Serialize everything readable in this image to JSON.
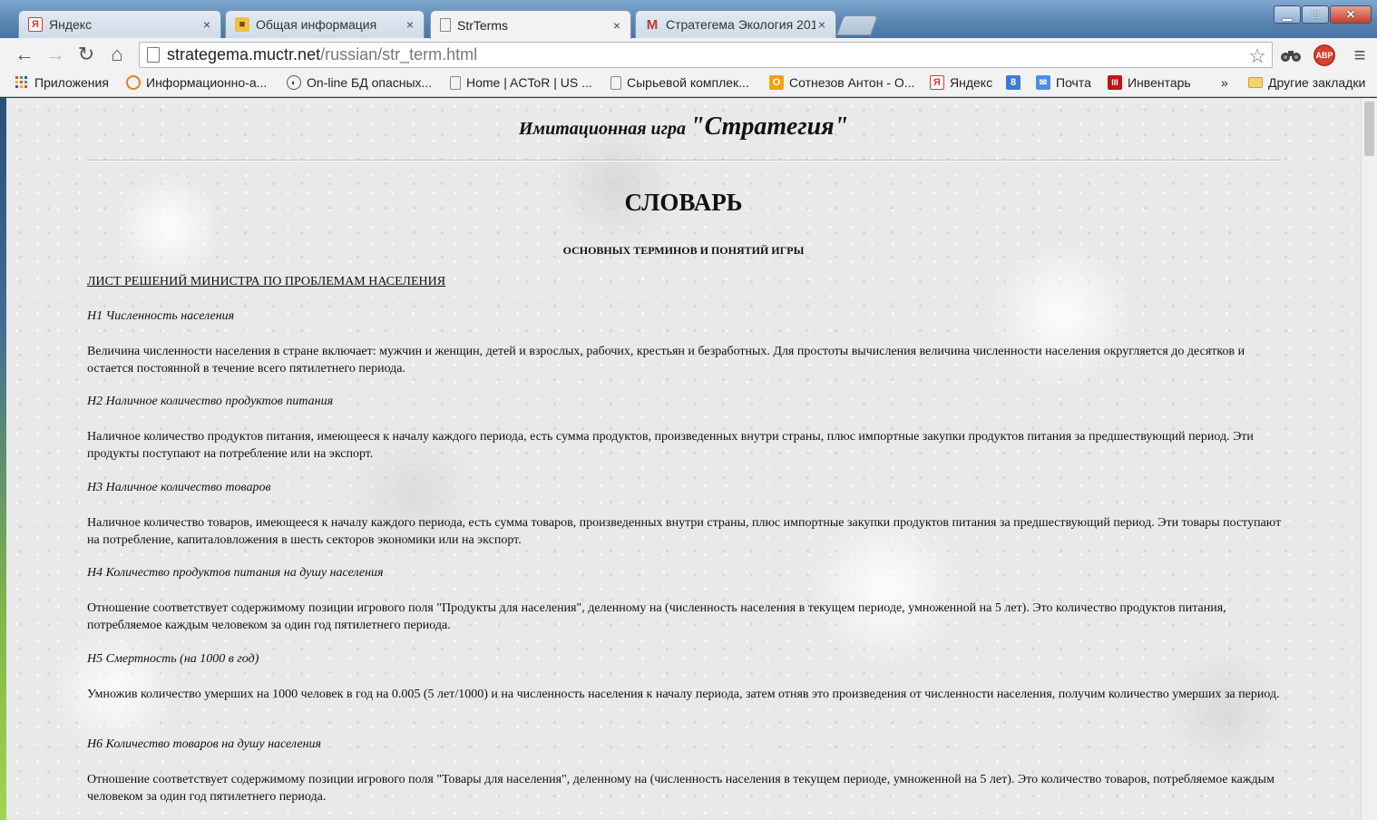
{
  "browser": {
    "tabs": [
      {
        "title": "Яндекс",
        "icon": "yandex-icon"
      },
      {
        "title": "Общая информация",
        "icon": "info-icon"
      },
      {
        "title": "StrTerms",
        "icon": "page-icon",
        "active": true
      },
      {
        "title": "Стратегема Экология 201",
        "icon": "gmail-icon"
      }
    ],
    "close_glyph": "×",
    "address": {
      "host": "strategema.muctr.net",
      "path": "/russian/str_term.html"
    },
    "abp_label": "ABP",
    "bookmarks": [
      {
        "label": "Приложения",
        "icon": "apps-grid-icon"
      },
      {
        "label": "Информационно-а...",
        "icon": "info-circle-icon"
      },
      {
        "label": "On-line БД опасных...",
        "icon": "globe-icon"
      },
      {
        "label": "Home | ACToR | US ...",
        "icon": "page-icon"
      },
      {
        "label": "Сырьевой комплек...",
        "icon": "page-icon"
      },
      {
        "label": "Сотнезов Антон - О...",
        "icon": "outlook-icon"
      },
      {
        "label": "Яндекс",
        "icon": "yandex-icon"
      },
      {
        "label": "",
        "icon": "google-plus-icon"
      },
      {
        "label": "Почта",
        "icon": "mail-icon"
      },
      {
        "label": "Инвентарь",
        "icon": "inventory-icon"
      }
    ],
    "bookmarks_overflow": "»",
    "other_bookmarks": "Другие закладки"
  },
  "page": {
    "game_title_prefix": "Имитационная игра",
    "game_title_name": "\"Стратегия\"",
    "title": "СЛОВАРЬ",
    "subtitle": "ОСНОВНЫХ ТЕРМИНОВ И ПОНЯТИЙ ИГРЫ",
    "section_link": "ЛИСТ РЕШЕНИЙ МИНИСТРА ПО ПРОБЛЕМАМ НАСЕЛЕНИЯ",
    "terms": [
      {
        "term": "Н1 Численность населения",
        "text": "Величина численности населения в стране включает: мужчин и женщин, детей и взрослых, рабочих, крестьян и безработных. Для простоты вычисления величина численности населения округляется до десятков и остается постоянной в течение всего пятилетнего периода."
      },
      {
        "term": "Н2 Наличное количество продуктов питания",
        "text": "Наличное количество продуктов питания, имеющееся к началу каждого периода, есть сумма продуктов, произведенных внутри страны, плюс импортные закупки продуктов питания за предшествующий период. Эти продукты поступают на потребление или на экспорт."
      },
      {
        "term": "Н3 Наличное количество товаров",
        "text": "Наличное количество товаров, имеющееся к началу каждого периода, есть сумма товаров, произведенных внутри страны, плюс импортные закупки продуктов питания за предшествующий период. Эти товары поступают на потребление, капиталовложения в шесть секторов экономики или на экспорт."
      },
      {
        "term": "Н4 Количество продуктов питания на душу населения",
        "text": "Отношение соответствует содержимому позиции игрового поля \"Продукты для населения\", деленному на (численность населения в текущем периоде, умноженной на 5 лет). Это количество продуктов питания, потребляемое каждым человеком за один год пятилетнего периода."
      },
      {
        "term": "Н5 Смертность (на 1000 в год)",
        "text": "Умножив количество умерших на 1000 человек в год на 0.005 (5 лет/1000) и на численность населения к началу периода, затем отняв это произведения от численности населения, получим количество умерших за период."
      },
      {
        "term": "Н6 Количество товаров на душу населения",
        "text": "Отношение соответствует содержимому позиции игрового поля \"Товары для населения\", деленному на (численность населения в текущем периоде, умноженной на 5 лет). Это количество товаров, потребляемое каждым человеком за один год пятилетнего периода."
      }
    ]
  }
}
